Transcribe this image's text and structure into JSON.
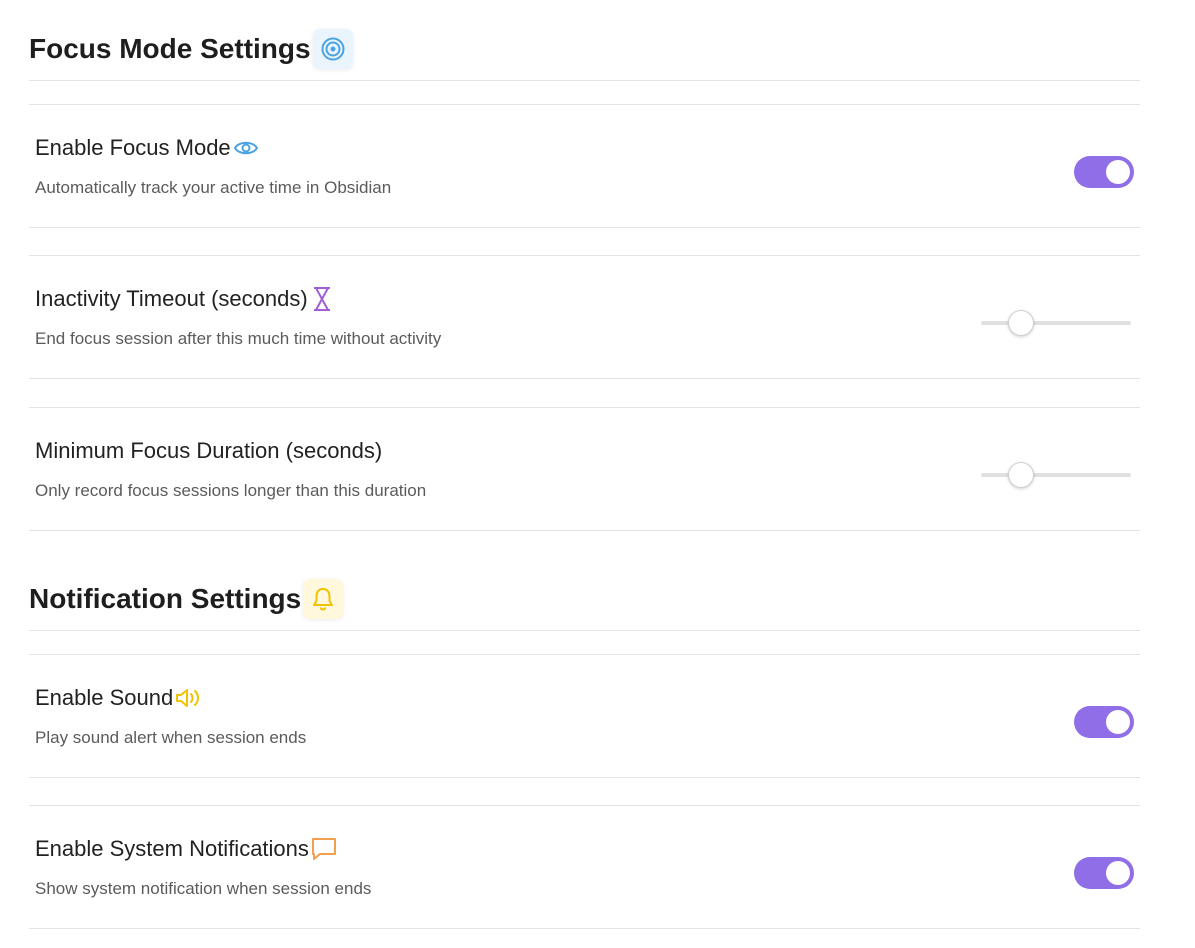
{
  "sections": [
    {
      "title": "Focus Mode Settings",
      "icon": "target-icon",
      "settings": [
        {
          "name": "Enable Focus Mode",
          "icon": "eye-icon",
          "description": "Automatically track your active time in Obsidian",
          "control": "toggle",
          "enabled": true
        },
        {
          "name": "Inactivity Timeout (seconds)",
          "icon": "hourglass-icon",
          "description": "End focus session after this much time without activity",
          "control": "slider",
          "level": 0.22
        },
        {
          "name": "Minimum Focus Duration (seconds)",
          "description": "Only record focus sessions longer than this duration",
          "control": "slider",
          "level": 0.22
        }
      ]
    },
    {
      "title": "Notification Settings",
      "icon": "bell-icon",
      "settings": [
        {
          "name": "Enable Sound",
          "icon": "speaker-icon",
          "description": "Play sound alert when session ends",
          "control": "toggle",
          "enabled": true
        },
        {
          "name": "Enable System Notifications",
          "icon": "message-icon",
          "description": "Show system notification when session ends",
          "control": "toggle",
          "enabled": true
        }
      ]
    }
  ],
  "colors": {
    "toggle_on": "#8f6ee8",
    "target_icon": "#4aa3e0",
    "eye_icon": "#4aa3e0",
    "hourglass_icon": "#a35ed6",
    "bell_icon": "#f2c200",
    "speaker_icon": "#f2c200",
    "message_icon": "#f0a050"
  }
}
